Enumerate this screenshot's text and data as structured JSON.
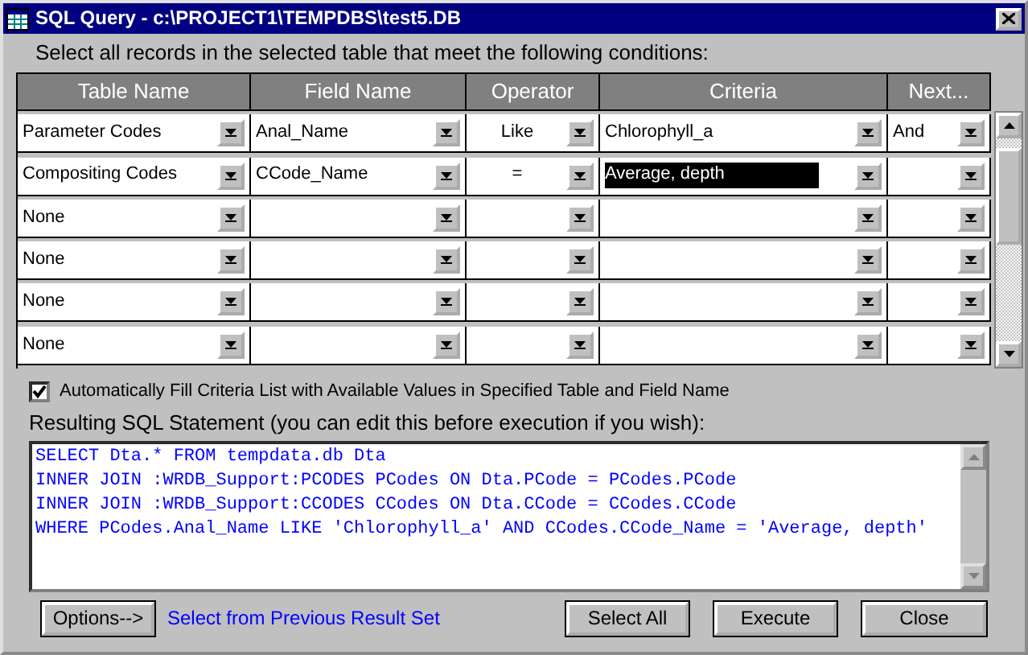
{
  "window": {
    "title": "SQL Query - c:\\PROJECT1\\TEMPDBS\\test5.DB"
  },
  "instruction": "Select all records in the selected table that meet the following conditions:",
  "columns": [
    "Table Name",
    "Field Name",
    "Operator",
    "Criteria",
    "Next..."
  ],
  "rows": [
    {
      "table": "Parameter Codes",
      "field": "Anal_Name",
      "operator": "Like",
      "criteria": "Chlorophyll_a",
      "criteria_selected": false,
      "next": "And"
    },
    {
      "table": "Compositing Codes",
      "field": "CCode_Name",
      "operator": "=",
      "criteria": "Average, depth",
      "criteria_selected": true
    },
    {
      "table": "None",
      "criteria_selected": false
    },
    {
      "table": "None",
      "criteria_selected": false
    },
    {
      "table": "None",
      "criteria_selected": false
    },
    {
      "table": "None",
      "criteria_selected": false
    }
  ],
  "autofill": {
    "label": "Automatically Fill Criteria List with Available Values in Specified Table and Field Name",
    "checked": true
  },
  "sql_label": "Resulting SQL Statement (you can edit this before execution if you wish):",
  "sql_lines": [
    "SELECT Dta.* FROM tempdata.db Dta",
    "INNER JOIN :WRDB_Support:PCODES PCodes ON Dta.PCode = PCodes.PCode",
    "INNER JOIN :WRDB_Support:CCODES CCodes ON Dta.CCode = CCodes.CCode",
    "WHERE PCodes.Anal_Name LIKE 'Chlorophyll_a' AND CCodes.CCode_Name = 'Average, depth'"
  ],
  "options_button": "Options-->",
  "previous_link": "Select from Previous Result Set",
  "buttons": [
    "Select All",
    "Execute",
    "Close"
  ]
}
